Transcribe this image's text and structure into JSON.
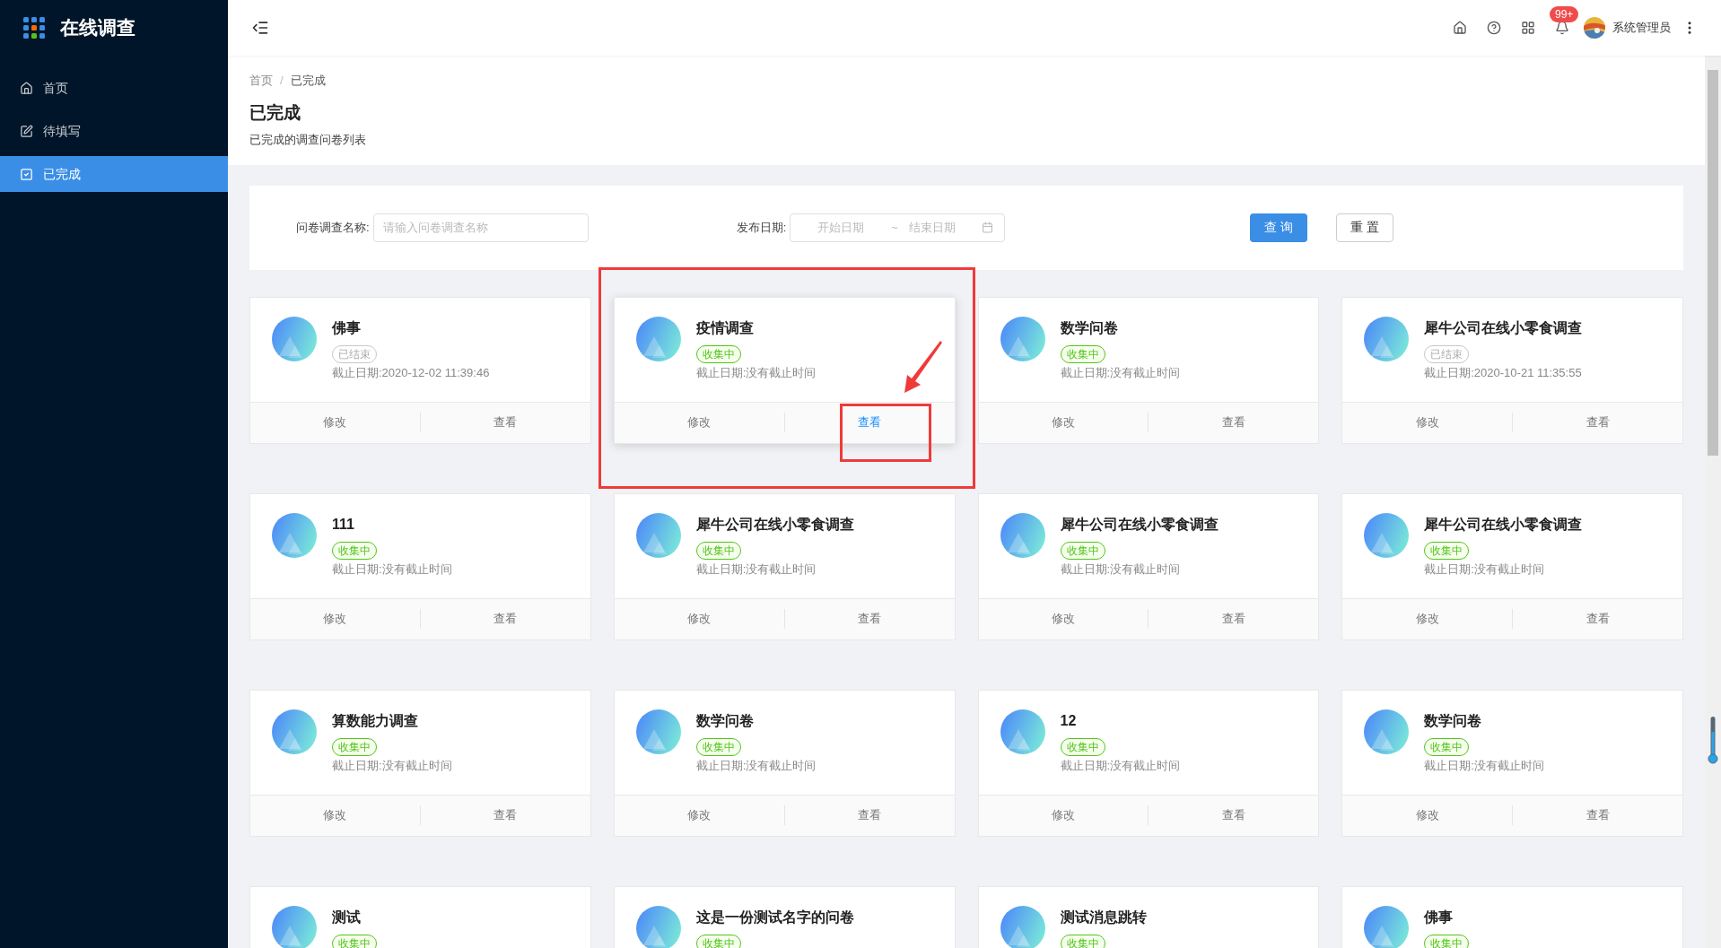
{
  "app": {
    "title": "在线调查"
  },
  "sidebar": {
    "items": [
      {
        "label": "首页",
        "kind": "home",
        "selected": false
      },
      {
        "label": "待填写",
        "kind": "edit",
        "selected": false
      },
      {
        "label": "已完成",
        "kind": "check",
        "selected": true
      }
    ]
  },
  "header": {
    "notifications_badge": "99+",
    "user_name": "系统管理员"
  },
  "breadcrumb": {
    "items": [
      "首页",
      "已完成"
    ],
    "separator": "/"
  },
  "page": {
    "title": "已完成",
    "subtitle": "已完成的调查问卷列表"
  },
  "filter": {
    "name_label": "问卷调查名称:",
    "name_placeholder": "请输入问卷调查名称",
    "date_label": "发布日期:",
    "start_placeholder": "开始日期",
    "separator": "~",
    "end_placeholder": "结束日期",
    "search_button": "查 询",
    "reset_button": "重 置"
  },
  "cards": [
    {
      "title": "佛事",
      "status": "已结束",
      "kind": "ended",
      "deadline": "截止日期:2020-12-02 11:39:46",
      "edit": "修改",
      "view": "查看",
      "hovered": false
    },
    {
      "title": "疫情调查",
      "status": "收集中",
      "kind": "collecting",
      "deadline": "截止日期:没有截止时间",
      "edit": "修改",
      "view": "查看",
      "hovered": true
    },
    {
      "title": "数学问卷",
      "status": "收集中",
      "kind": "collecting",
      "deadline": "截止日期:没有截止时间",
      "edit": "修改",
      "view": "查看",
      "hovered": false
    },
    {
      "title": "犀牛公司在线小零食调查",
      "status": "已结束",
      "kind": "ended",
      "deadline": "截止日期:2020-10-21 11:35:55",
      "edit": "修改",
      "view": "查看",
      "hovered": false
    },
    {
      "title": "111",
      "status": "收集中",
      "kind": "collecting",
      "deadline": "截止日期:没有截止时间",
      "edit": "修改",
      "view": "查看",
      "hovered": false
    },
    {
      "title": "犀牛公司在线小零食调查",
      "status": "收集中",
      "kind": "collecting",
      "deadline": "截止日期:没有截止时间",
      "edit": "修改",
      "view": "查看",
      "hovered": false
    },
    {
      "title": "犀牛公司在线小零食调查",
      "status": "收集中",
      "kind": "collecting",
      "deadline": "截止日期:没有截止时间",
      "edit": "修改",
      "view": "查看",
      "hovered": false
    },
    {
      "title": "犀牛公司在线小零食调查",
      "status": "收集中",
      "kind": "collecting",
      "deadline": "截止日期:没有截止时间",
      "edit": "修改",
      "view": "查看",
      "hovered": false
    },
    {
      "title": "算数能力调查",
      "status": "收集中",
      "kind": "collecting",
      "deadline": "截止日期:没有截止时间",
      "edit": "修改",
      "view": "查看",
      "hovered": false
    },
    {
      "title": "数学问卷",
      "status": "收集中",
      "kind": "collecting",
      "deadline": "截止日期:没有截止时间",
      "edit": "修改",
      "view": "查看",
      "hovered": false
    },
    {
      "title": "12",
      "status": "收集中",
      "kind": "collecting",
      "deadline": "截止日期:没有截止时间",
      "edit": "修改",
      "view": "查看",
      "hovered": false
    },
    {
      "title": "数学问卷",
      "status": "收集中",
      "kind": "collecting",
      "deadline": "截止日期:没有截止时间",
      "edit": "修改",
      "view": "查看",
      "hovered": false
    },
    {
      "title": "测试",
      "status": "收集中",
      "kind": "collecting",
      "hovered": false
    },
    {
      "title": "这是一份测试名字的问卷",
      "status": "收集中",
      "kind": "collecting",
      "hovered": false
    },
    {
      "title": "测试消息跳转",
      "status": "收集中",
      "kind": "collecting",
      "hovered": false
    },
    {
      "title": "佛事",
      "status": "收集中",
      "kind": "collecting",
      "hovered": false
    }
  ]
}
